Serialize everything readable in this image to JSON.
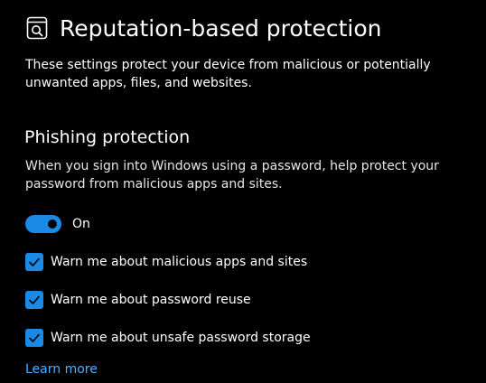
{
  "header": {
    "icon": "app-browser-control-icon",
    "title": "Reputation-based protection"
  },
  "description": "These settings protect your device from malicious or potentially unwanted apps, files, and websites.",
  "phishing": {
    "title": "Phishing protection",
    "description": "When you sign into Windows using a password, help protect your password from malicious apps and sites.",
    "toggle": {
      "state": "on",
      "label": "On"
    },
    "checkboxes": [
      {
        "label": "Warn me about malicious apps and sites",
        "checked": true
      },
      {
        "label": "Warn me about password reuse",
        "checked": true
      },
      {
        "label": "Warn me about unsafe password storage",
        "checked": true
      }
    ],
    "learn_more": "Learn more"
  },
  "colors": {
    "background": "#000000",
    "accent": "#1a8ae6",
    "link": "#4cb0ff",
    "text": "#ffffff"
  }
}
